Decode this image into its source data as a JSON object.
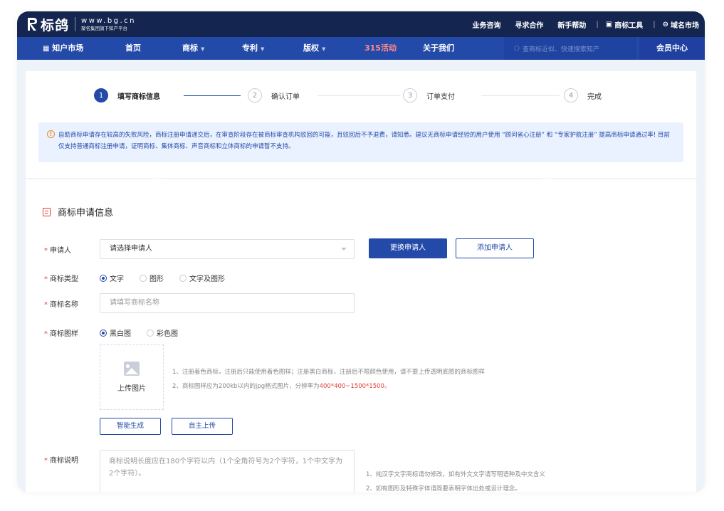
{
  "brand": {
    "name": "标鸽",
    "url": "www.bg.cn",
    "slogan": "聚名集团旗下知产平台"
  },
  "top_links": [
    {
      "label": "业务咨询"
    },
    {
      "label": "寻求合作"
    },
    {
      "label": "新手帮助"
    },
    {
      "label": "商标工具"
    },
    {
      "label": "域名市场"
    }
  ],
  "nav": {
    "market": "知户市场",
    "items": [
      {
        "label": "首页"
      },
      {
        "label": "商标"
      },
      {
        "label": "专利"
      },
      {
        "label": "版权"
      },
      {
        "label": "315活动"
      },
      {
        "label": "关于我们"
      }
    ],
    "search_placeholder": "查商标近似、快速搜索知产",
    "member_center": "会员中心",
    "highlight_color": "#ff8a8a"
  },
  "steps": [
    {
      "num": "1",
      "label": "填写商标信息",
      "active": true
    },
    {
      "num": "2",
      "label": "确认订单",
      "active": false
    },
    {
      "num": "3",
      "label": "订单支付",
      "active": false
    },
    {
      "num": "4",
      "label": "完成",
      "active": false
    }
  ],
  "notice": {
    "icon": "!",
    "text": "自助商标申请存在较高的失败风险，商标注册申请递交后，在审查阶段存在被商标审查机构驳回的可能，且驳回后不予退费，请知悉。建议无商标申请经验的用户使用 “顾问省心注册” 和 “专家护航注册” 提高商标申请通过率! 目前仅支持普通商标注册申请，证明商标、集体商标、声音商标和立体商标的申请暂不支持。"
  },
  "form": {
    "section_title": "商标申请信息",
    "required_mark": "*",
    "applicant": {
      "label": "申请人",
      "placeholder": "请选择申请人",
      "change_button": "更换申请人",
      "add_button": "添加申请人"
    },
    "trademark_type": {
      "label": "商标类型",
      "options": [
        {
          "label": "文字",
          "checked": true
        },
        {
          "label": "图形",
          "checked": false
        },
        {
          "label": "文字及图形",
          "checked": false
        }
      ]
    },
    "trademark_name": {
      "label": "商标名称",
      "placeholder": "请填写商标名称"
    },
    "trademark_style": {
      "label": "商标图样",
      "options": [
        {
          "label": "黑白图",
          "checked": true
        },
        {
          "label": "彩色图",
          "checked": false
        }
      ],
      "upload_label": "上传图片",
      "tip1": "1、注册着色商标，注册后只能使用着色图样；注册黑白商标，注册后不限颜色使用，请不要上传透明底图的商标图样",
      "tip2_prefix": "2、商标图样应为200kb以内的jpg格式图片，分辨率为",
      "tip2_highlight": "400*400~1500*1500",
      "tip2_suffix": "。",
      "smart_button": "智能生成",
      "self_upload_button": "自主上传"
    },
    "trademark_desc": {
      "label": "商标说明",
      "placeholder": "商标说明长度应在180个字符以内（1个全角符号为2个字符，1个中文字为2个字符）。",
      "tip1": "1、纯汉字文字商标请勿修改，如有外文文字请写明语种及中文含义",
      "tip2": "2、如有图形及特殊字体请简要表明字体出处或设计理念。"
    }
  },
  "colors": {
    "primary": "#234aa8",
    "topbar": "#14254f",
    "danger": "#e0403a",
    "warning": "#f08a1f"
  }
}
